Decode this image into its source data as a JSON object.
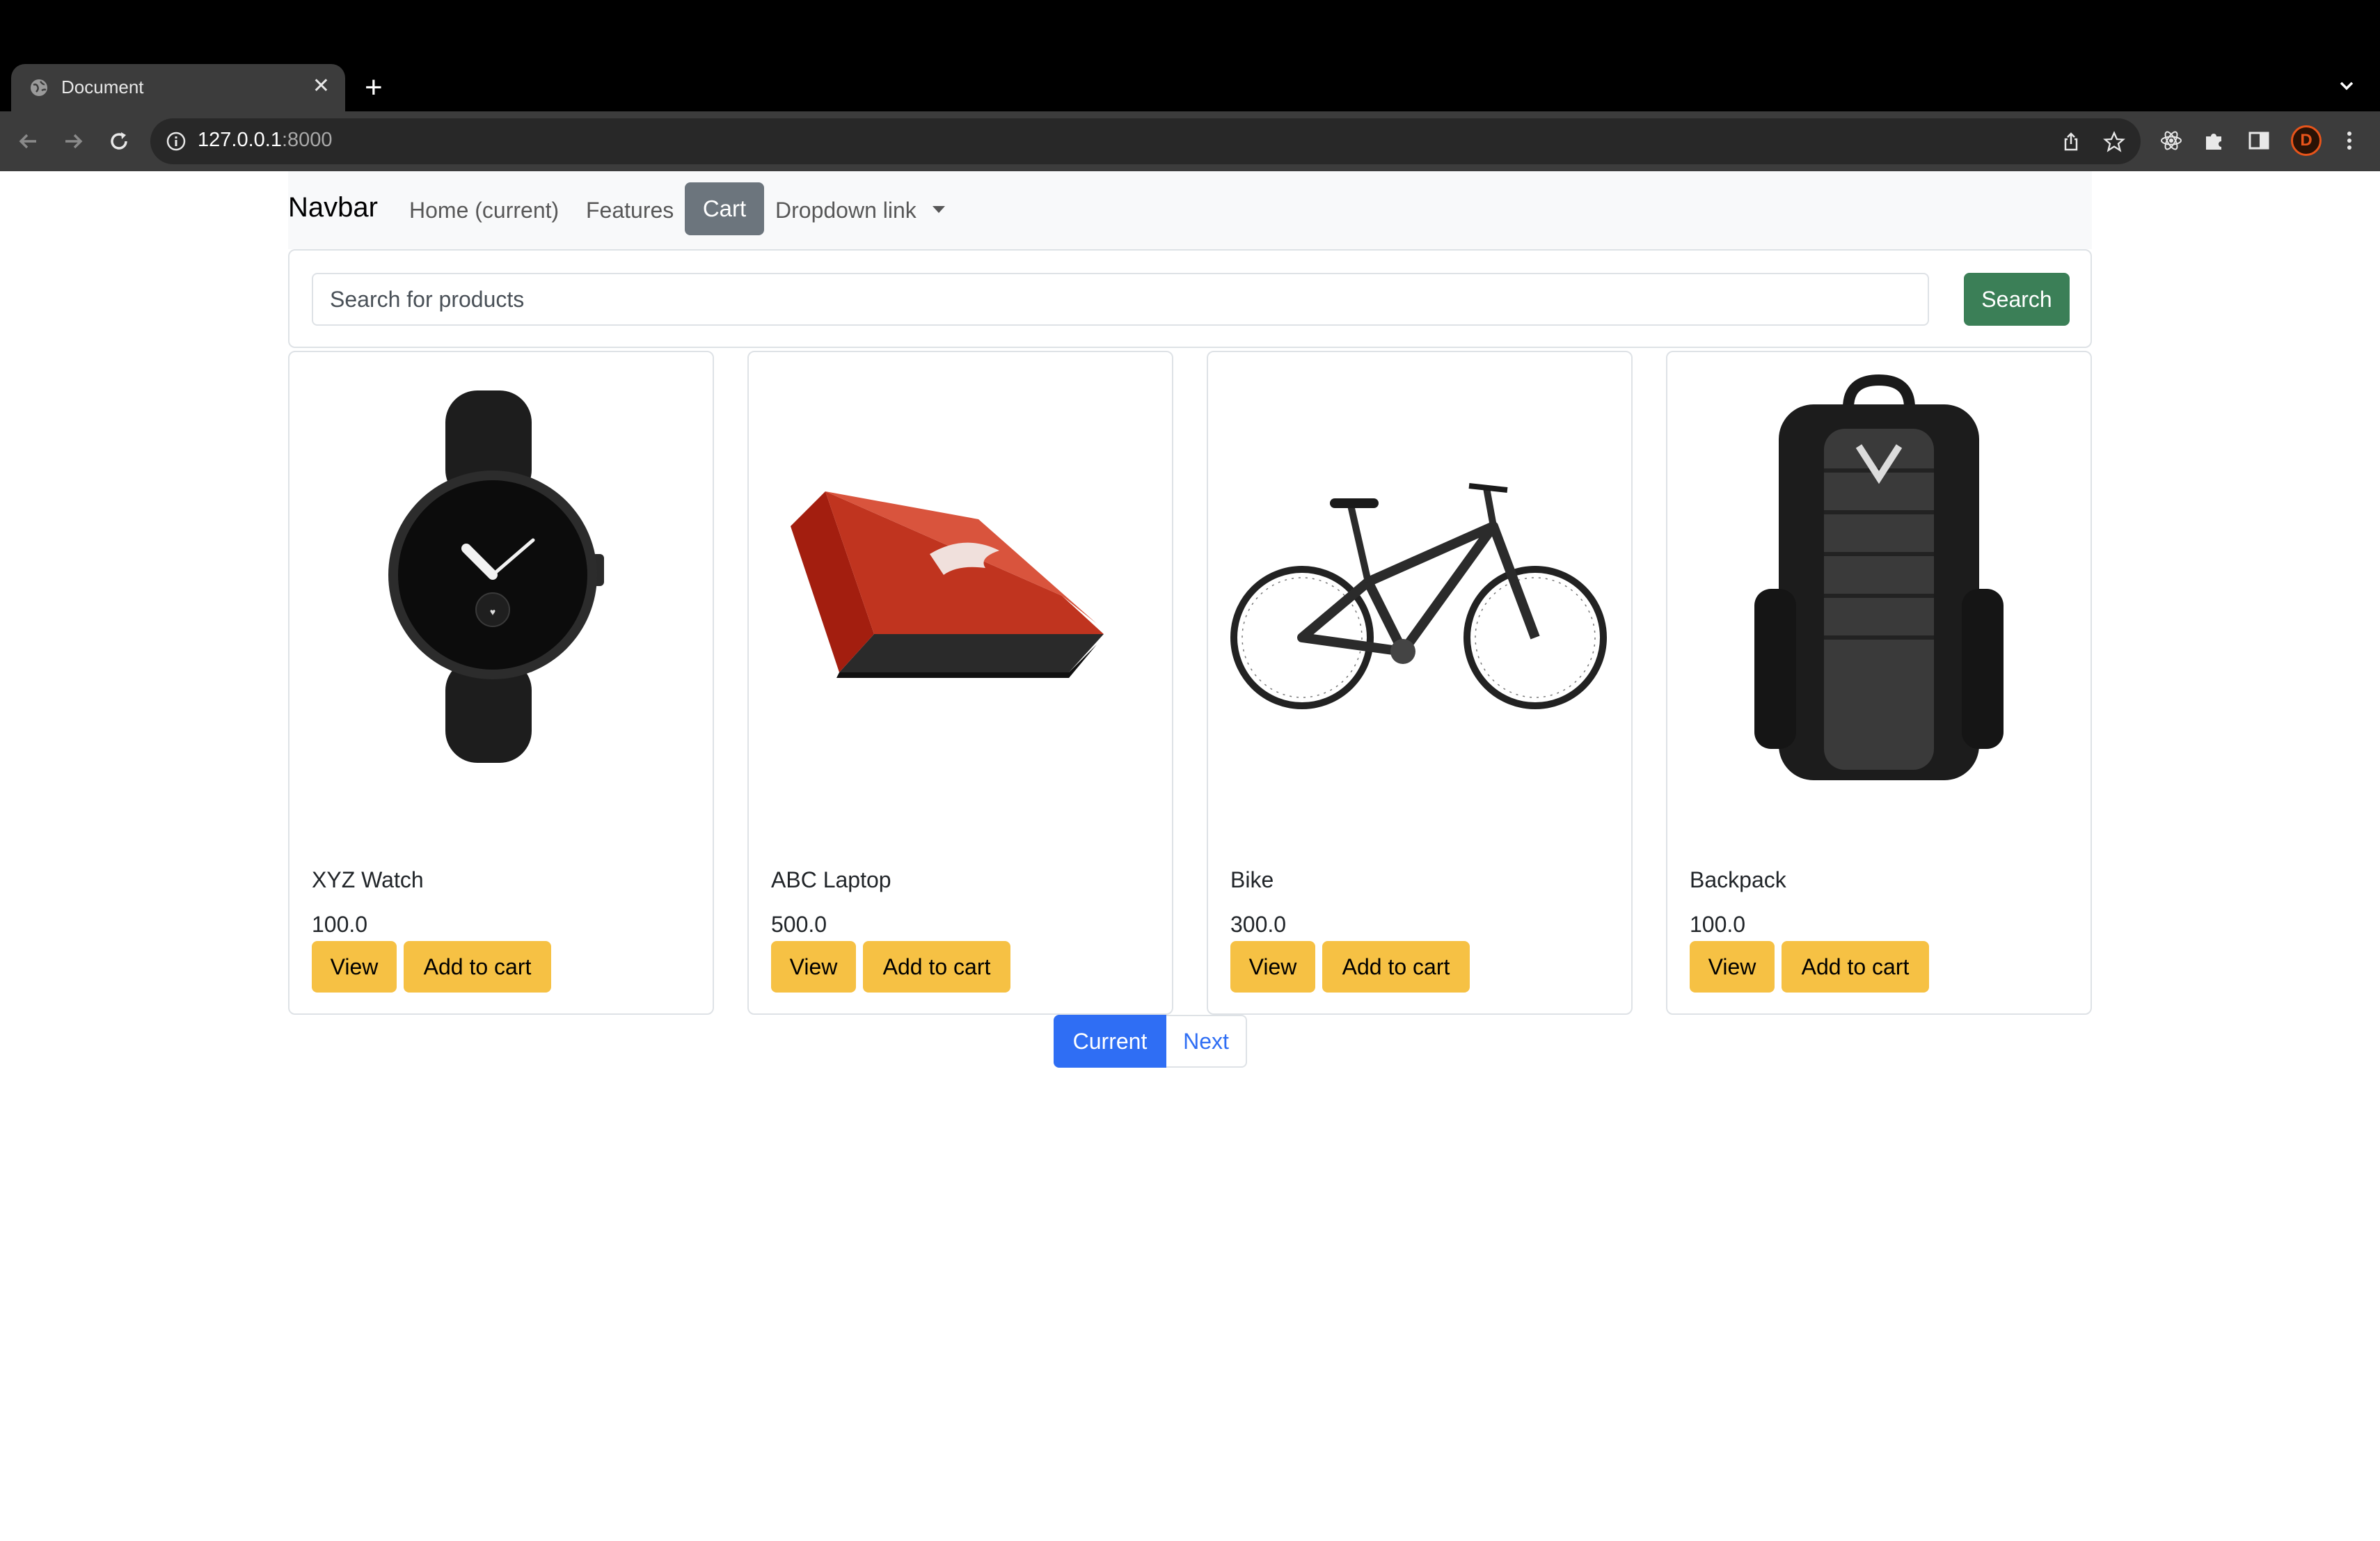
{
  "browser": {
    "tab_title": "Document",
    "url_host": "127.0.0.1",
    "url_port": ":8000"
  },
  "navbar": {
    "brand": "Navbar",
    "links": [
      "Home (current)",
      "Features",
      "Cart",
      "Dropdown link"
    ]
  },
  "search": {
    "placeholder": "Search for products",
    "button_label": "Search"
  },
  "products": [
    {
      "name": "XYZ Watch",
      "price": "100.0",
      "view_label": "View",
      "add_label": "Add to cart",
      "image_icon": "smartwatch-image"
    },
    {
      "name": "ABC Laptop",
      "price": "500.0",
      "view_label": "View",
      "add_label": "Add to cart",
      "image_icon": "laptop-image"
    },
    {
      "name": "Bike",
      "price": "300.0",
      "view_label": "View",
      "add_label": "Add to cart",
      "image_icon": "bike-image"
    },
    {
      "name": "Backpack",
      "price": "100.0",
      "view_label": "View",
      "add_label": "Add to cart",
      "image_icon": "backpack-image"
    }
  ],
  "pagination": {
    "current_label": "Current",
    "next_label": "Next"
  },
  "profile": {
    "initial": "D"
  },
  "colors": {
    "accent_blue": "#2f6ef4",
    "search_green": "#3b7f57",
    "button_yellow": "#f6c144",
    "cart_gray": "#6c757d"
  }
}
